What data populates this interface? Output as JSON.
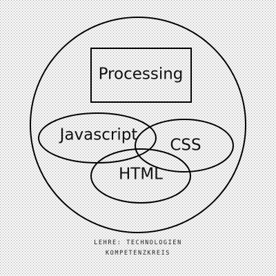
{
  "diagram": {
    "box_label": "Processing",
    "ellipses": {
      "javascript": "Javascript",
      "css": "CSS",
      "html": "HTML"
    }
  },
  "caption": {
    "line1": "LEHRE: TECHNOLOGIEN",
    "line2": "KOMPETENZKREIS"
  },
  "colors": {
    "stroke": "#000000",
    "text": "#111111",
    "background": "#f4f4f4",
    "dot_pattern": "#9a9a9a"
  }
}
